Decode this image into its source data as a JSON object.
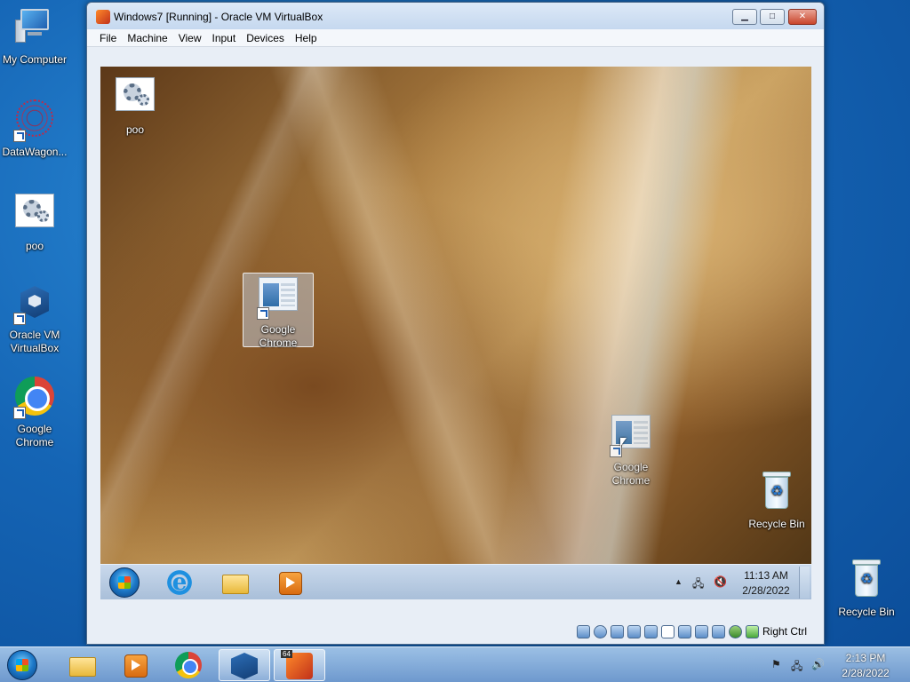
{
  "host_desktop": {
    "icons": [
      {
        "label": "My Computer",
        "icon": "computer-icon"
      },
      {
        "label": "DataWagon...",
        "icon": "datawagon-icon"
      },
      {
        "label": "poo",
        "icon": "gear-file-icon"
      },
      {
        "label": "Oracle VM VirtualBox",
        "icon": "virtualbox-icon"
      },
      {
        "label": "Google Chrome",
        "icon": "chrome-icon"
      },
      {
        "label": "Recycle Bin",
        "icon": "recycle-bin-icon"
      }
    ]
  },
  "vbox_window": {
    "title": "Windows7 [Running] - Oracle VM VirtualBox",
    "buttons": {
      "minimize": "▁",
      "maximize": "□",
      "close": "✕"
    },
    "menu": [
      "File",
      "Machine",
      "View",
      "Input",
      "Devices",
      "Help"
    ],
    "host_key_label": "Right Ctrl"
  },
  "guest_desktop": {
    "icons": [
      {
        "label": "poo",
        "icon": "gear-file-icon"
      },
      {
        "label": "Google Chrome",
        "icon": "app-window-icon",
        "selected": true
      },
      {
        "label": "Google Chrome",
        "icon": "app-window-icon",
        "dragging": true
      },
      {
        "label": "Recycle Bin",
        "icon": "recycle-bin-icon"
      }
    ],
    "taskbar": {
      "clock_time": "11:13 AM",
      "clock_date": "2/28/2022",
      "tray_chevron": "▲"
    }
  },
  "host_taskbar": {
    "clock_time": "2:13 PM",
    "clock_date": "2/28/2022"
  }
}
